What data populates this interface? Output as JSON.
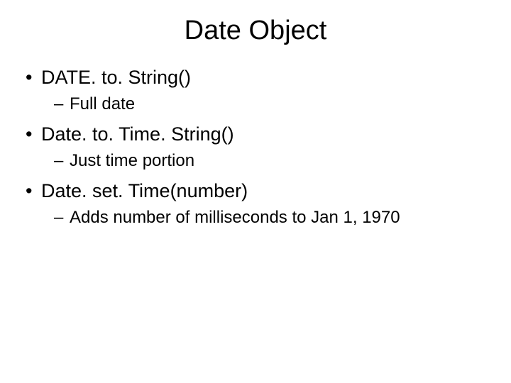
{
  "title": "Date Object",
  "items": [
    {
      "text": "DATE. to. String()",
      "sub": "Full date"
    },
    {
      "text": "Date. to. Time. String()",
      "sub": "Just time portion"
    },
    {
      "text": "Date. set. Time(number)",
      "sub": "Adds number of milliseconds to Jan 1, 1970"
    }
  ]
}
